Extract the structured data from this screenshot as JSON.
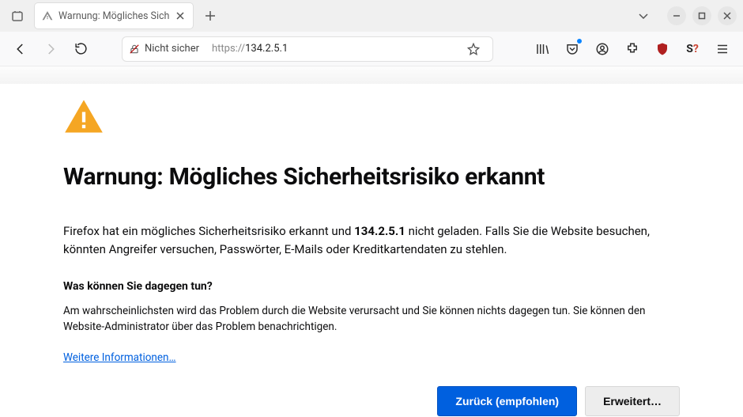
{
  "tab": {
    "title": "Warnung: Mögliches Sich"
  },
  "addressbar": {
    "security_label": "Nicht sicher",
    "scheme": "https://",
    "host": "134.2.5.1"
  },
  "page": {
    "heading": "Warnung: Mögliches Sicherheitsrisiko erkannt",
    "lead_pre": "Firefox hat ein mögliches Sicherheitsrisiko erkannt und ",
    "lead_host": "134.2.5.1",
    "lead_post": " nicht geladen. Falls Sie die Website besuchen, könnten Angreifer versuchen, Passwörter, E-Mails oder Kreditkartendaten zu stehlen.",
    "what_heading": "Was können Sie dagegen tun?",
    "what_body": "Am wahrscheinlichsten wird das Problem durch die Website verursacht und Sie können nichts dagegen tun. Sie können den Website-Administrator über das Problem benachrichtigen.",
    "more_link": "Weitere Informationen…",
    "btn_back": "Zurück (empfohlen)",
    "btn_advanced": "Erweitert…"
  }
}
